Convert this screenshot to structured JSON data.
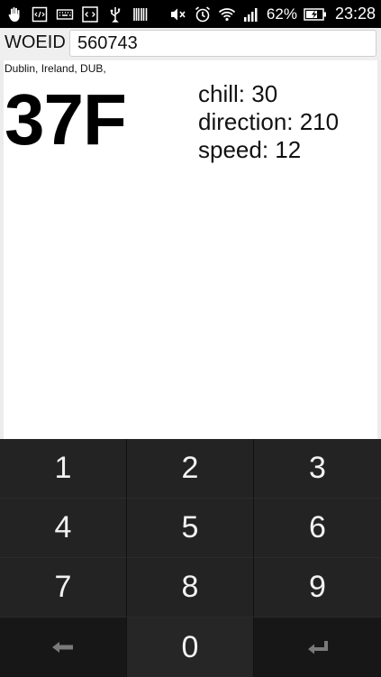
{
  "status_bar": {
    "battery_percent": "62%",
    "time": "23:28",
    "icons_left": [
      "hand-icon",
      "code-icon",
      "keyboard-icon",
      "code-box-icon",
      "usb-icon",
      "barcode-icon"
    ],
    "icons_right": [
      "muted-volume-icon",
      "alarm-icon",
      "wifi-icon",
      "signal-icon",
      "battery-charging-icon"
    ]
  },
  "form": {
    "woeid_label": "WOEID",
    "woeid_value": "560743"
  },
  "weather": {
    "location": "Dublin, Ireland, DUB,",
    "temperature": "37F",
    "chill": "chill: 30",
    "direction": "direction: 210",
    "speed": "speed: 12"
  },
  "keypad": {
    "keys": [
      "1",
      "2",
      "3",
      "4",
      "5",
      "6",
      "7",
      "8",
      "9"
    ],
    "zero": "0",
    "backspace_icon": "backspace-arrow-icon",
    "enter_icon": "enter-icon"
  }
}
